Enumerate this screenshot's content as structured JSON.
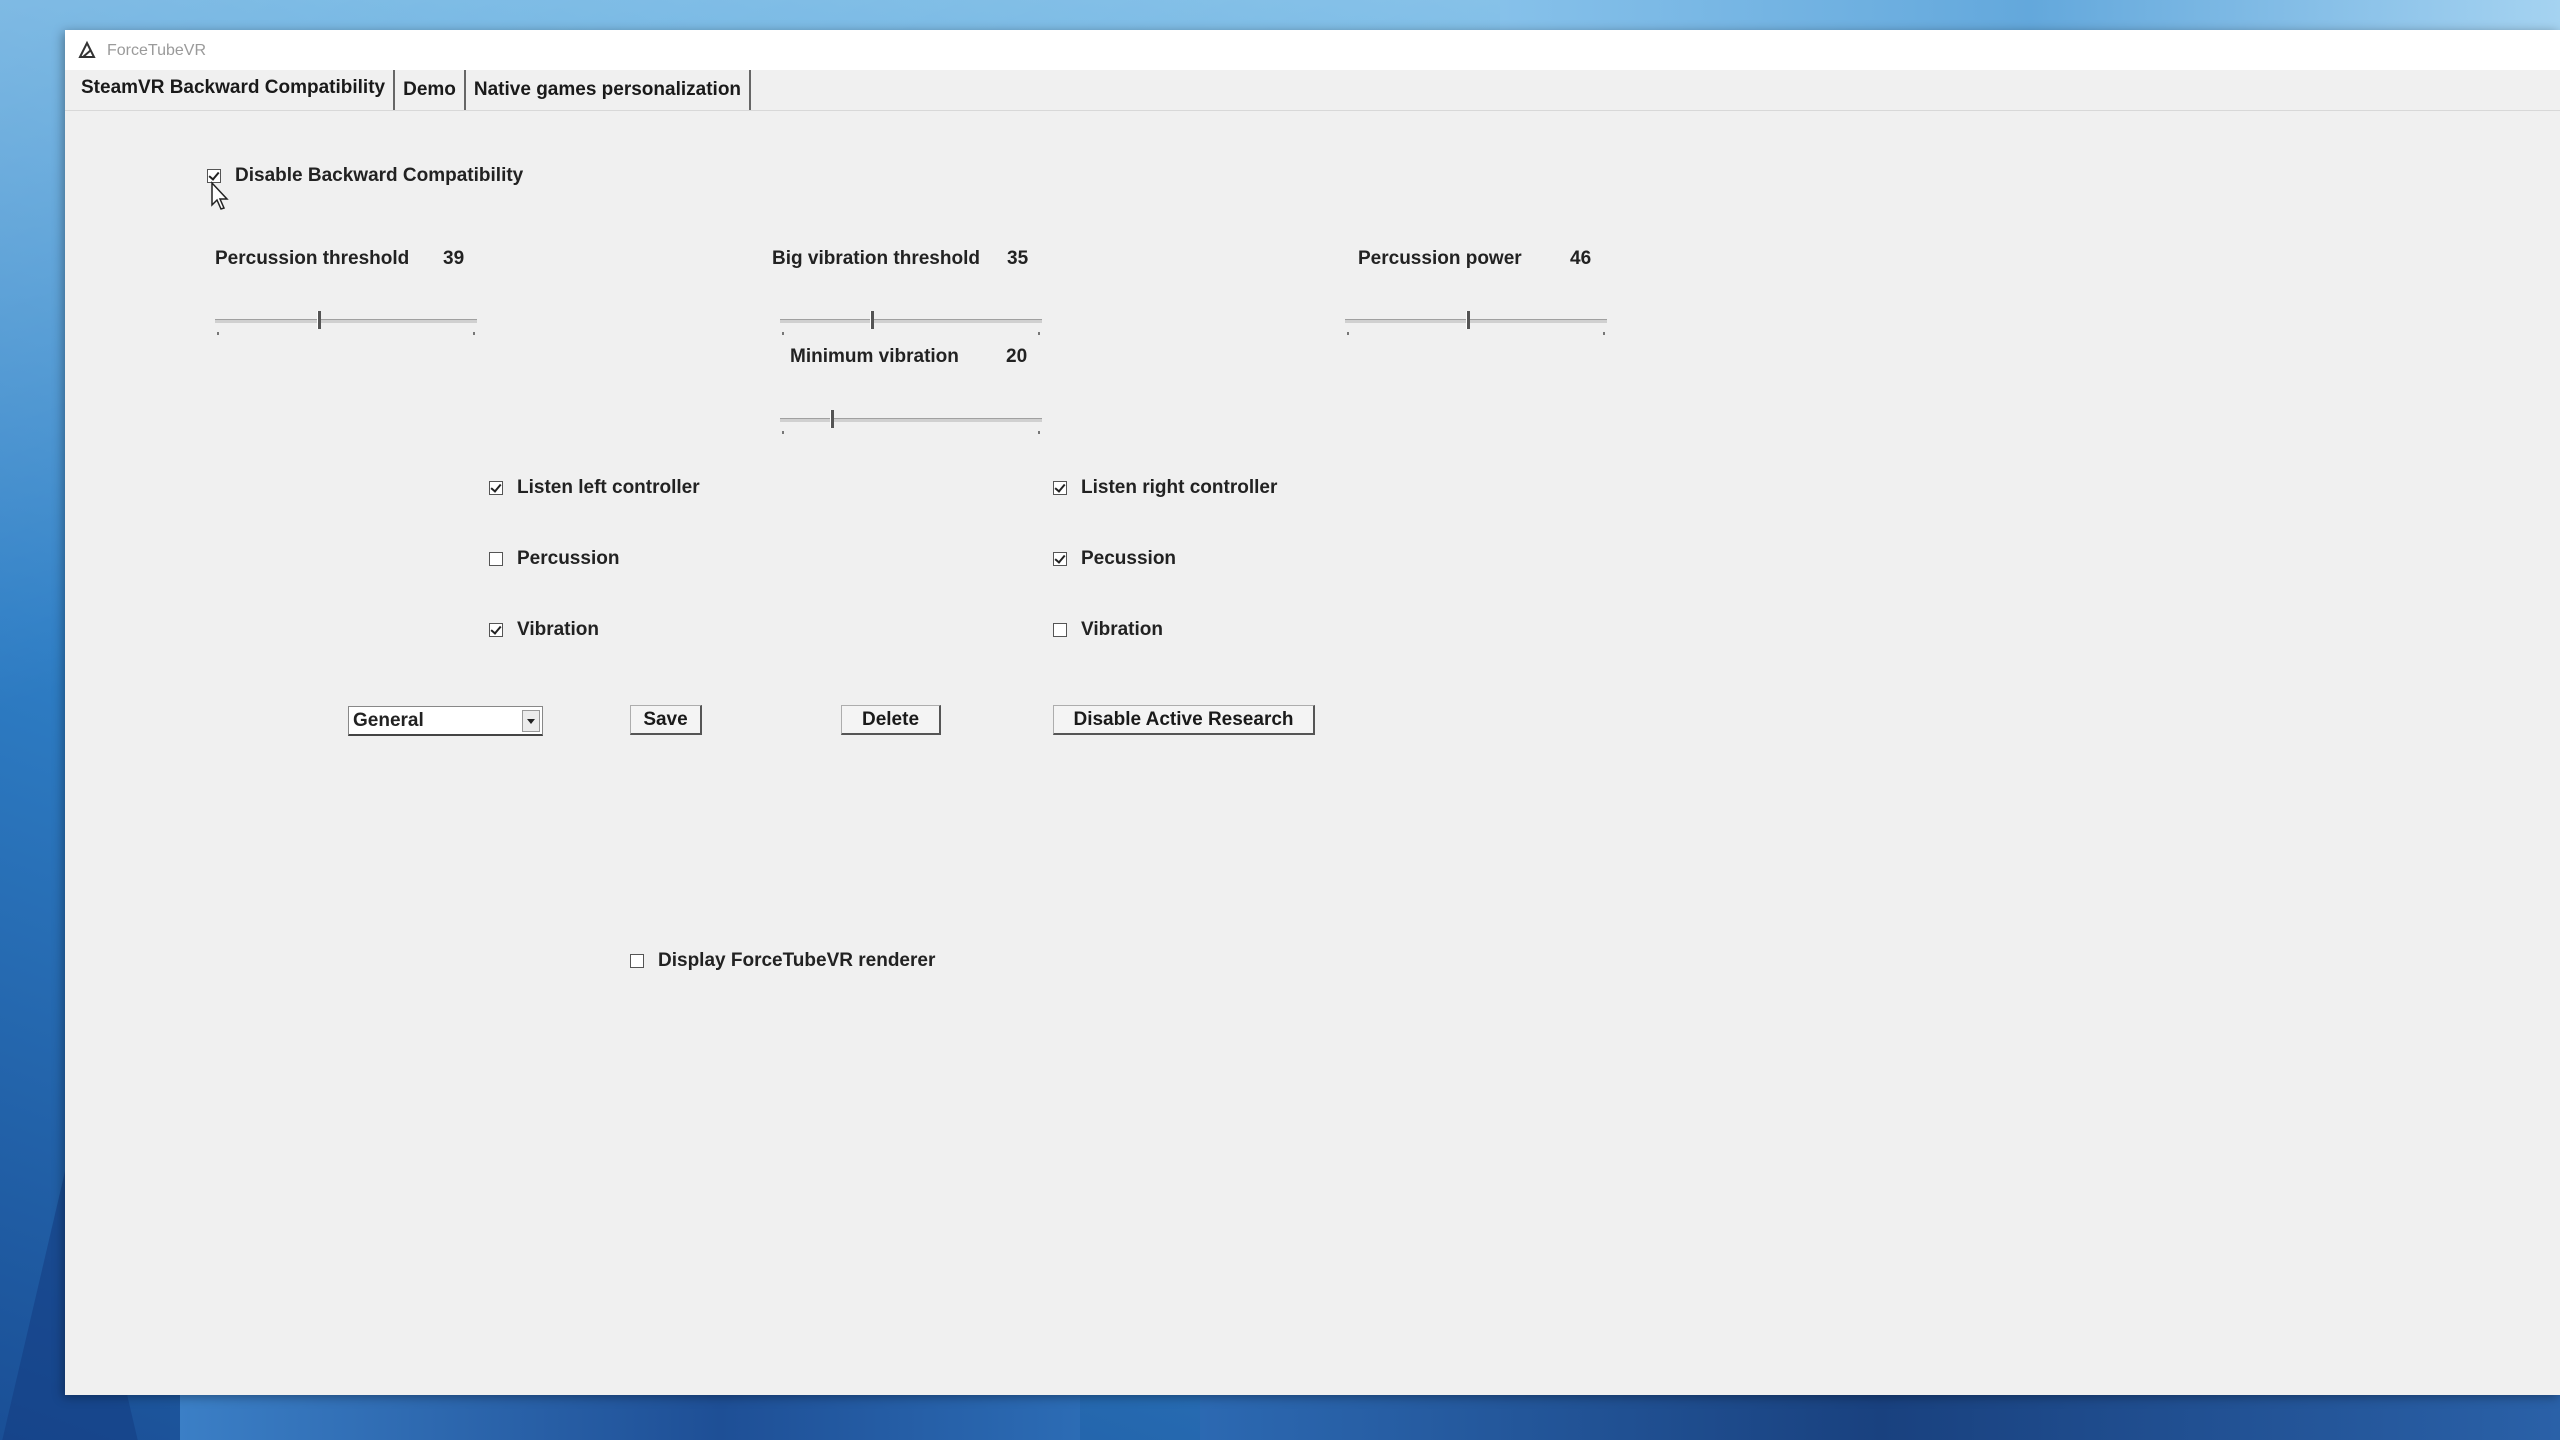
{
  "window": {
    "title": "ForceTubeVR"
  },
  "tabs": [
    {
      "label": "SteamVR Backward Compatibility",
      "active": true
    },
    {
      "label": "Demo",
      "active": false
    },
    {
      "label": "Native games personalization",
      "active": false
    }
  ],
  "backward_compat": {
    "label": "Disable Backward Compatibility",
    "checked": true
  },
  "sliders": {
    "percussion_threshold": {
      "label": "Percussion threshold",
      "value": "39"
    },
    "big_vibration_threshold": {
      "label": "Big vibration threshold",
      "value": "35"
    },
    "percussion_power": {
      "label": "Percussion power",
      "value": "46"
    },
    "minimum_vibration": {
      "label": "Minimum vibration",
      "value": "20"
    }
  },
  "left_controller": {
    "listen": {
      "label": "Listen left controller",
      "checked": true
    },
    "percussion": {
      "label": "Percussion",
      "checked": false
    },
    "vibration": {
      "label": "Vibration",
      "checked": true
    }
  },
  "right_controller": {
    "listen": {
      "label": "Listen right controller",
      "checked": true
    },
    "percussion": {
      "label": "Pecussion",
      "checked": true
    },
    "vibration": {
      "label": "Vibration",
      "checked": false
    }
  },
  "profile": {
    "selected": "General"
  },
  "buttons": {
    "save": "Save",
    "delete": "Delete",
    "disable_active_research": "Disable Active Research"
  },
  "renderer": {
    "label": "Display ForceTubeVR renderer",
    "checked": false
  },
  "icons": {
    "app": "forcetube-app-icon",
    "cursor": "mouse-pointer-icon"
  }
}
